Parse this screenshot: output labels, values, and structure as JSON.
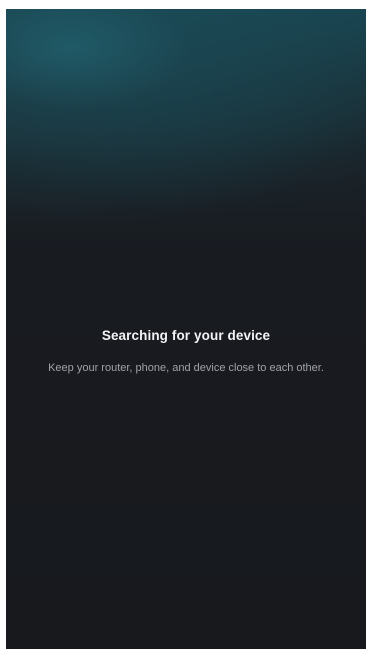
{
  "search_screen": {
    "title": "Searching for your device",
    "subtitle": "Keep your router, phone, and device close to each other."
  },
  "colors": {
    "background": "#17191d",
    "top_glow": "#1f5a66",
    "title_text": "#f2f3f4",
    "subtitle_text": "#9ea3a8"
  }
}
